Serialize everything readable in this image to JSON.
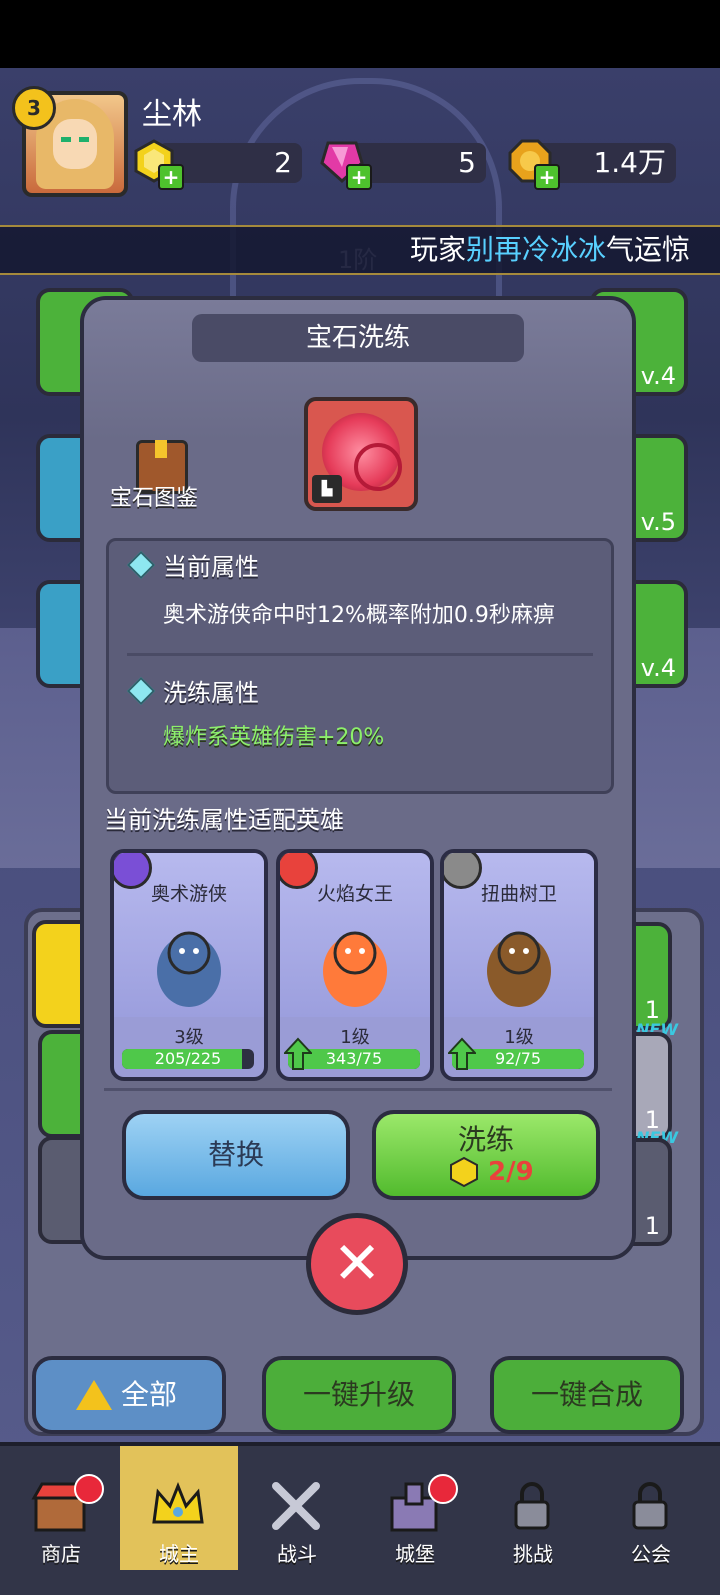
{
  "player": {
    "level": "3",
    "name": "尘林",
    "resources": [
      {
        "id": "gold-gem",
        "value": "2",
        "icon": "yellow-gem-icon"
      },
      {
        "id": "pink-gem",
        "value": "5",
        "icon": "pink-gem-icon"
      },
      {
        "id": "coin",
        "value": "1.4万",
        "icon": "coin-icon"
      }
    ]
  },
  "marquee": {
    "prefix": "玩家",
    "highlight": "别再冷冰冰",
    "suffix": "气运惊"
  },
  "background_slots": {
    "left_top_lv": "",
    "right_top_lv": "v.4",
    "right_mid_lv": "v.5",
    "right_low_lv": "v.4",
    "right_list": [
      "1",
      "1",
      "1"
    ],
    "new_badge": "NEW",
    "faded_tier": "1阶"
  },
  "modal": {
    "title": "宝石洗练",
    "codex_label": "宝石图鉴",
    "current_attr_title": "当前属性",
    "current_attr_text": "奥术游侠命中时12%概率附加0.9秒麻痹",
    "refine_attr_title": "洗练属性",
    "refine_attr_text": "爆炸系英雄伤害+20%",
    "heroes_title": "当前洗练属性适配英雄",
    "heroes": [
      {
        "name": "奥术游侠",
        "level": "3级",
        "progress": "205/225",
        "ratio": 0.91,
        "upgradable": false,
        "badge_color": "#7a4fd6"
      },
      {
        "name": "火焰女王",
        "level": "1级",
        "progress": "343/75",
        "ratio": 1.0,
        "upgradable": true,
        "badge_color": "#e8423c"
      },
      {
        "name": "扭曲树卫",
        "level": "1级",
        "progress": "92/75",
        "ratio": 1.0,
        "upgradable": true,
        "badge_color": "#8a8a8a"
      }
    ],
    "replace_label": "替换",
    "refine_label": "洗练",
    "refine_cost": "2/9"
  },
  "bottom_actions": {
    "all_label": "全部",
    "upgrade_label": "一键升级",
    "merge_label": "一键合成"
  },
  "nav": [
    {
      "label": "商店",
      "icon": "shop-icon",
      "dot": true
    },
    {
      "label": "城主",
      "icon": "crown-icon",
      "dot": false,
      "active": true
    },
    {
      "label": "战斗",
      "icon": "swords-icon",
      "dot": false
    },
    {
      "label": "城堡",
      "icon": "castle-icon",
      "dot": true
    },
    {
      "label": "挑战",
      "icon": "lock-icon",
      "dot": false
    },
    {
      "label": "公会",
      "icon": "lock-icon",
      "dot": false
    }
  ]
}
